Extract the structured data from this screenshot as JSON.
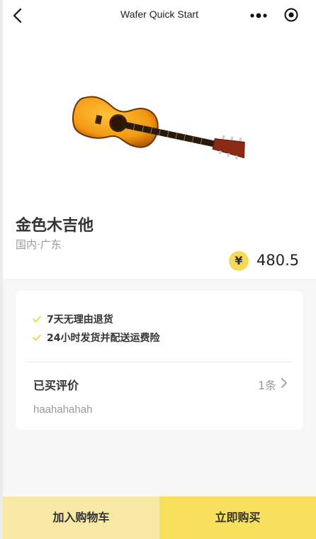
{
  "header": {
    "title": "Wafer Quick Start",
    "back_icon": "chevron-left-icon",
    "more_icon": "more-dots-icon",
    "close_icon": "target-close-icon"
  },
  "product": {
    "name": "金色木吉他",
    "origin": "国内·广东",
    "currency_symbol": "¥",
    "price": "480.5",
    "image": "acoustic-guitar-image"
  },
  "services": {
    "items": [
      {
        "label": "7天无理由退货"
      },
      {
        "label": "24小时发货并配送运费险"
      }
    ],
    "check_color": "#f5d04a"
  },
  "reviews": {
    "title": "已买评价",
    "count": "1条",
    "latest": "haahahahah"
  },
  "actions": {
    "add_to_cart": "加入购物车",
    "buy_now": "立即购买"
  },
  "colors": {
    "accent_light": "#f8e8a5",
    "accent": "#f7e05b",
    "price_badge": "#f5d957"
  }
}
